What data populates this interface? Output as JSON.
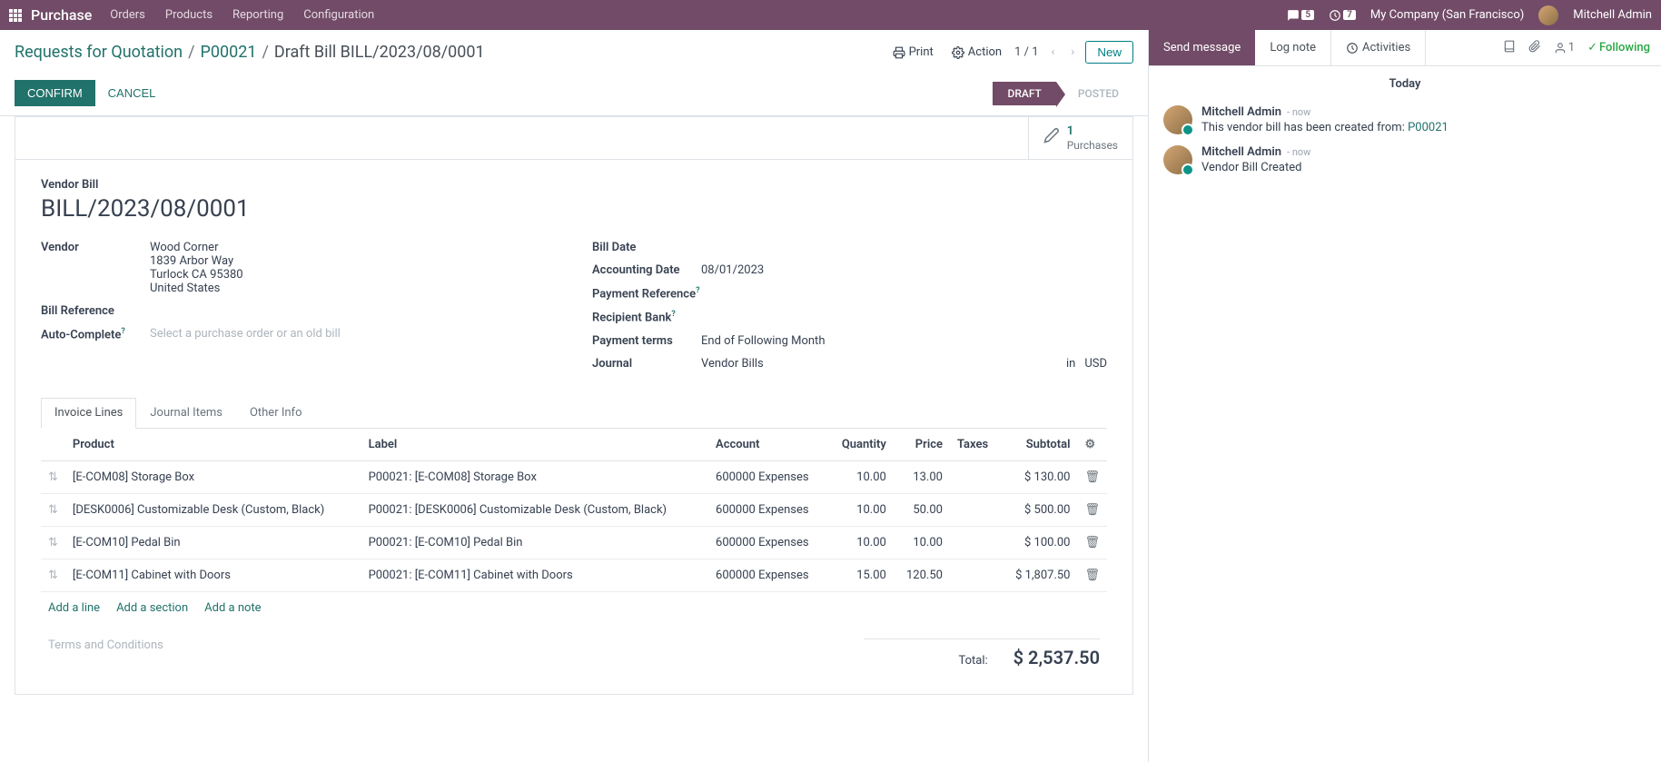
{
  "nav": {
    "brand": "Purchase",
    "menu": [
      "Orders",
      "Products",
      "Reporting",
      "Configuration"
    ],
    "chat_badge": "5",
    "clock_badge": "7",
    "company": "My Company (San Francisco)",
    "user": "Mitchell Admin"
  },
  "breadcrumb": {
    "root": "Requests for Quotation",
    "parent": "P00021",
    "current": "Draft Bill BILL/2023/08/0001"
  },
  "controls": {
    "print": "Print",
    "action": "Action",
    "pager": "1 / 1",
    "new": "New"
  },
  "statusbar": {
    "confirm": "CONFIRM",
    "cancel": "CANCEL",
    "steps": [
      "DRAFT",
      "POSTED"
    ]
  },
  "stat_button": {
    "count": "1",
    "label": "Purchases"
  },
  "form": {
    "doc_type": "Vendor Bill",
    "doc_title": "BILL/2023/08/0001",
    "labels": {
      "vendor": "Vendor",
      "bill_ref": "Bill Reference",
      "auto_complete": "Auto-Complete",
      "bill_date": "Bill Date",
      "accounting_date": "Accounting Date",
      "payment_ref": "Payment Reference",
      "recipient_bank": "Recipient Bank",
      "payment_terms": "Payment terms",
      "journal": "Journal"
    },
    "vendor": {
      "name": "Wood Corner",
      "street": "1839 Arbor Way",
      "city": "Turlock CA 95380",
      "country": "United States"
    },
    "auto_complete_placeholder": "Select a purchase order or an old bill",
    "accounting_date": "08/01/2023",
    "payment_terms": "End of Following Month",
    "journal": "Vendor Bills",
    "journal_in": "in",
    "journal_currency": "USD"
  },
  "tabs": [
    "Invoice Lines",
    "Journal Items",
    "Other Info"
  ],
  "table": {
    "headers": {
      "product": "Product",
      "label": "Label",
      "account": "Account",
      "quantity": "Quantity",
      "price": "Price",
      "taxes": "Taxes",
      "subtotal": "Subtotal"
    },
    "rows": [
      {
        "product": "[E-COM08] Storage Box",
        "label": "P00021: [E-COM08] Storage Box",
        "account": "600000 Expenses",
        "quantity": "10.00",
        "price": "13.00",
        "subtotal": "$ 130.00"
      },
      {
        "product": "[DESK0006] Customizable Desk (Custom, Black)",
        "label": "P00021: [DESK0006] Customizable Desk (Custom, Black)",
        "account": "600000 Expenses",
        "quantity": "10.00",
        "price": "50.00",
        "subtotal": "$ 500.00"
      },
      {
        "product": "[E-COM10] Pedal Bin",
        "label": "P00021: [E-COM10] Pedal Bin",
        "account": "600000 Expenses",
        "quantity": "10.00",
        "price": "10.00",
        "subtotal": "$ 100.00"
      },
      {
        "product": "[E-COM11] Cabinet with Doors",
        "label": "P00021: [E-COM11] Cabinet with Doors",
        "account": "600000 Expenses",
        "quantity": "15.00",
        "price": "120.50",
        "subtotal": "$ 1,807.50"
      }
    ],
    "add_links": [
      "Add a line",
      "Add a section",
      "Add a note"
    ]
  },
  "footer": {
    "terms_placeholder": "Terms and Conditions",
    "total_label": "Total:",
    "total_amount": "$ 2,537.50"
  },
  "chatter": {
    "send_message": "Send message",
    "log_note": "Log note",
    "activities": "Activities",
    "follower_count": "1",
    "following": "Following",
    "date": "Today",
    "messages": [
      {
        "author": "Mitchell Admin",
        "time": "now",
        "text_prefix": "This vendor bill has been created from: ",
        "link": "P00021"
      },
      {
        "author": "Mitchell Admin",
        "time": "now",
        "text": "Vendor Bill Created"
      }
    ]
  }
}
